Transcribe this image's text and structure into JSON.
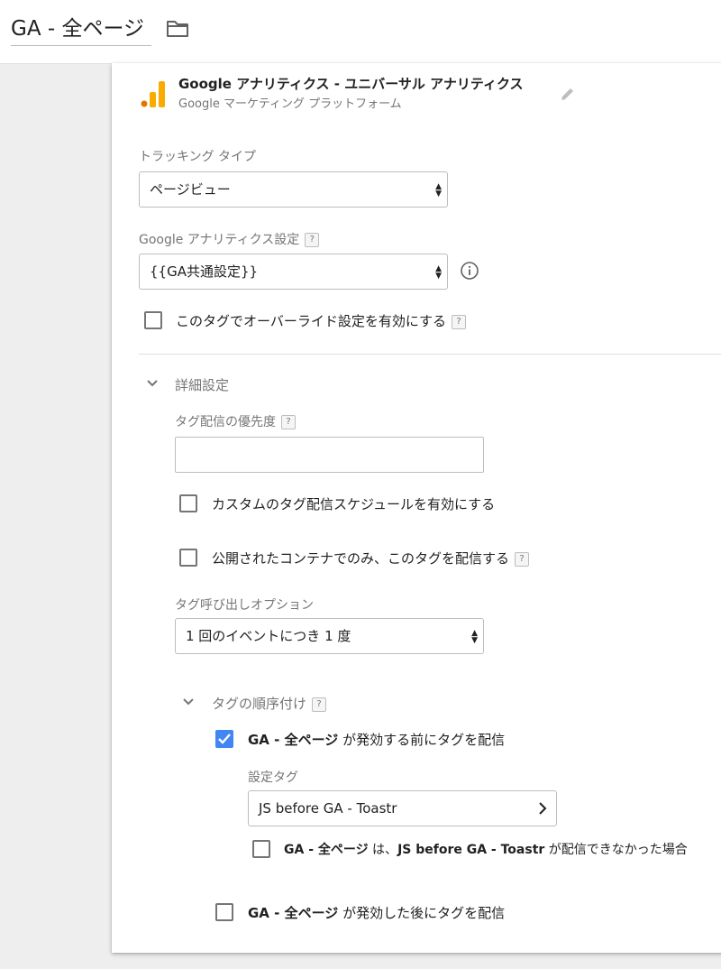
{
  "header": {
    "tag_name": "GA - 全ページ",
    "folder_icon": "folder-icon"
  },
  "tag_type": {
    "icon": "google-analytics-logo-icon",
    "name": "Google アナリティクス - ユニバーサル アナリティクス",
    "subtitle": "Google マーケティング プラットフォーム",
    "edit_icon": "pencil-icon"
  },
  "tracking_type": {
    "label": "トラッキング タイプ",
    "value": "ページビュー"
  },
  "ga_settings": {
    "label": "Google アナリティクス設定",
    "help": "?",
    "value": "{{GA共通設定}}",
    "info_icon": "info-icon"
  },
  "override": {
    "label": "このタグでオーバーライド設定を有効にする",
    "help": "?",
    "checked": false
  },
  "advanced": {
    "title": "詳細設定",
    "priority": {
      "label": "タグ配信の優先度",
      "help": "?",
      "value": ""
    },
    "custom_schedule": {
      "label": "カスタムのタグ配信スケジュールを有効にする",
      "checked": false
    },
    "published_only": {
      "label": "公開されたコンテナでのみ、このタグを配信する",
      "help": "?",
      "checked": false
    },
    "firing_option": {
      "label": "タグ呼び出しオプション",
      "value": "1 回のイベントにつき 1 度"
    },
    "sequencing": {
      "title": "タグの順序付け",
      "help": "?",
      "setup": {
        "tag_bold": "GA - 全ページ",
        "text": " が発効する前にタグを配信",
        "checked": true,
        "setup_tag_label": "設定タグ",
        "setup_tag_value": "JS before GA - Toastr",
        "fail": {
          "part1": "GA - 全ページ",
          "part2": " は、",
          "part3": "JS before GA - Toastr",
          "part4": " が配信できなかった場合",
          "checked": false
        }
      },
      "cleanup": {
        "tag_bold": "GA - 全ページ",
        "text": " が発効した後にタグを配信",
        "checked": false
      }
    }
  },
  "colors": {
    "accent": "#4285f4",
    "ga_orange": "#f9ab00",
    "ga_dark_orange": "#e37400"
  }
}
